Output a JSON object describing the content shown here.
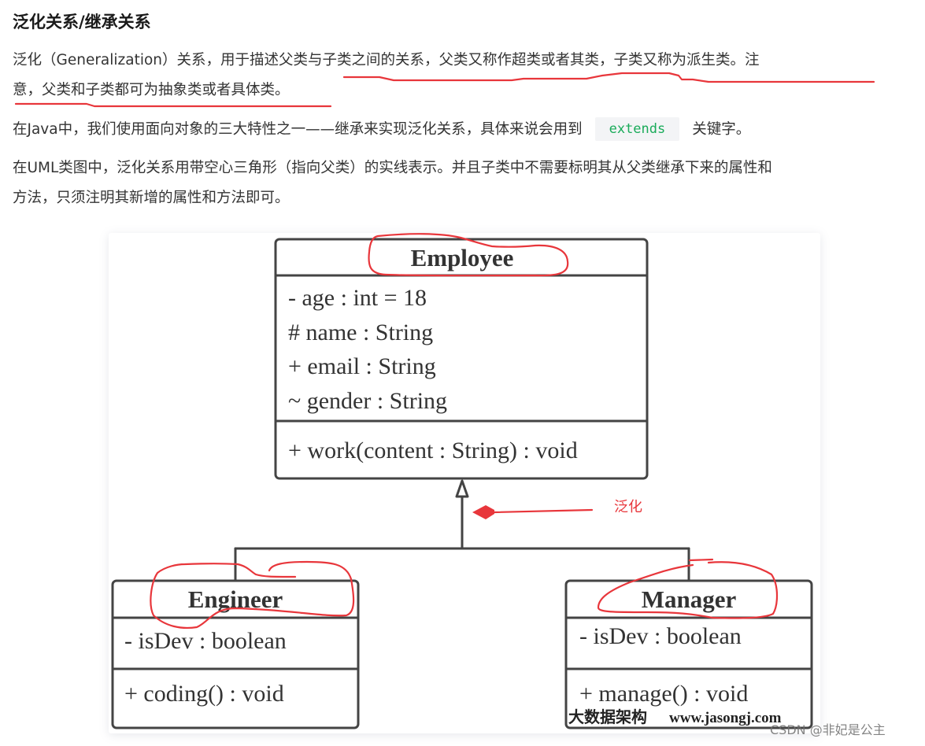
{
  "heading": "泛化关系/继承关系",
  "paragraphs": {
    "p1_line1": "泛化（Generalization）关系，用于描述父类与子类之间的关系，父类又称作超类或者其类，子类又称为派生类。注",
    "p1_line2": "意，父类和子类都可为抽象类或者具体类。",
    "p2_before": "在Java中，我们使用面向对象的三大特性之一——继承来实现泛化关系，具体来说会用到",
    "p2_code": "extends",
    "p2_after": "关键字。",
    "p3_line1": "在UML类图中，泛化关系用带空心三角形（指向父类）的实线表示。并且子类中不需要标明其从父类继承下来的属性和",
    "p3_line2": "方法，只须注明其新增的属性和方法即可。"
  },
  "diagram": {
    "parent": {
      "name": "Employee",
      "attributes": [
        "- age : int = 18",
        "# name : String",
        "+ email : String",
        "~ gender : String"
      ],
      "methods": [
        "+ work(content : String) : void"
      ]
    },
    "children": [
      {
        "name": "Engineer",
        "attributes": [
          "- isDev : boolean"
        ],
        "methods": [
          "+ coding() : void"
        ]
      },
      {
        "name": "Manager",
        "attributes": [
          "- isDev : boolean"
        ],
        "methods": [
          "+ manage() : void"
        ]
      }
    ],
    "annotation_label": "泛化",
    "watermark_cn": "大数据架构",
    "watermark_url": "www.jasongj.com"
  },
  "colors": {
    "annotation_red": "#e8363b",
    "code_green": "#1aab5a",
    "code_bg": "#f3f4f6",
    "uml_stroke": "#444444"
  },
  "credit": "CSDN @非妃是公主"
}
